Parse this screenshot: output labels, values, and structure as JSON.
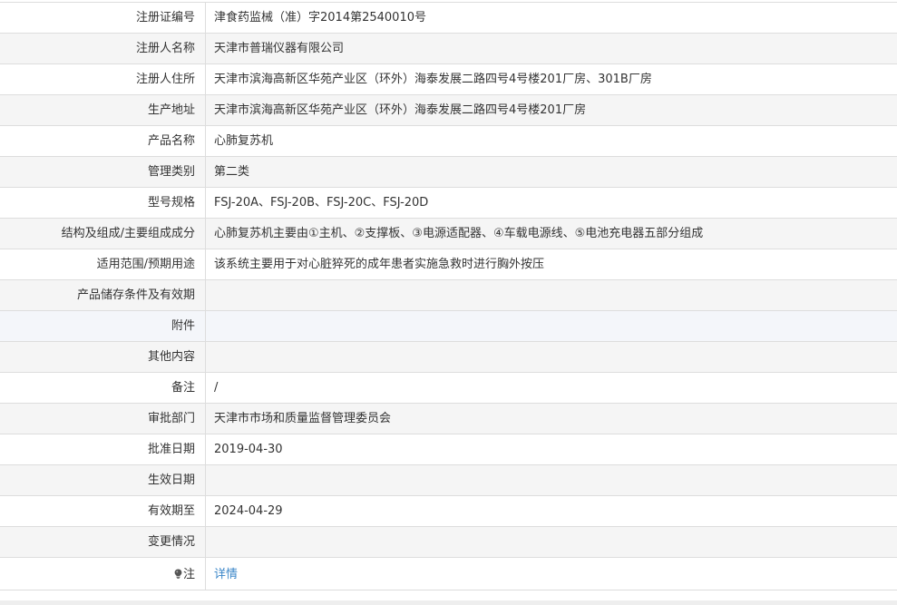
{
  "rows": [
    {
      "label": "注册证编号",
      "value": "津食药监械（准）字2014第2540010号"
    },
    {
      "label": "注册人名称",
      "value": "天津市普瑞仪器有限公司"
    },
    {
      "label": "注册人住所",
      "value": "天津市滨海高新区华苑产业区（环外）海泰发展二路四号4号楼201厂房、301B厂房"
    },
    {
      "label": "生产地址",
      "value": "天津市滨海高新区华苑产业区（环外）海泰发展二路四号4号楼201厂房"
    },
    {
      "label": "产品名称",
      "value": "心肺复苏机"
    },
    {
      "label": "管理类别",
      "value": "第二类"
    },
    {
      "label": "型号规格",
      "value": "FSJ-20A、FSJ-20B、FSJ-20C、FSJ-20D"
    },
    {
      "label": "结构及组成/主要组成成分",
      "value": "心肺复苏机主要由①主机、②支撑板、③电源适配器、④车载电源线、⑤电池充电器五部分组成"
    },
    {
      "label": "适用范围/预期用途",
      "value": "该系统主要用于对心脏猝死的成年患者实施急救时进行胸外按压"
    },
    {
      "label": "产品储存条件及有效期",
      "value": ""
    },
    {
      "label": "附件",
      "value": ""
    },
    {
      "label": "其他内容",
      "value": ""
    },
    {
      "label": "备注",
      "value": "/"
    },
    {
      "label": "审批部门",
      "value": "天津市市场和质量监督管理委员会"
    },
    {
      "label": "批准日期",
      "value": "2019-04-30"
    },
    {
      "label": "生效日期",
      "value": ""
    },
    {
      "label": "有效期至",
      "value": "2024-04-29"
    },
    {
      "label": "变更情况",
      "value": ""
    }
  ],
  "note": {
    "label": "注",
    "icon": "lightbulb-icon",
    "link_text": "详情"
  },
  "colors": {
    "link": "#3a86c8",
    "border": "#dddddd",
    "alt_row": "#f5f5f5"
  }
}
